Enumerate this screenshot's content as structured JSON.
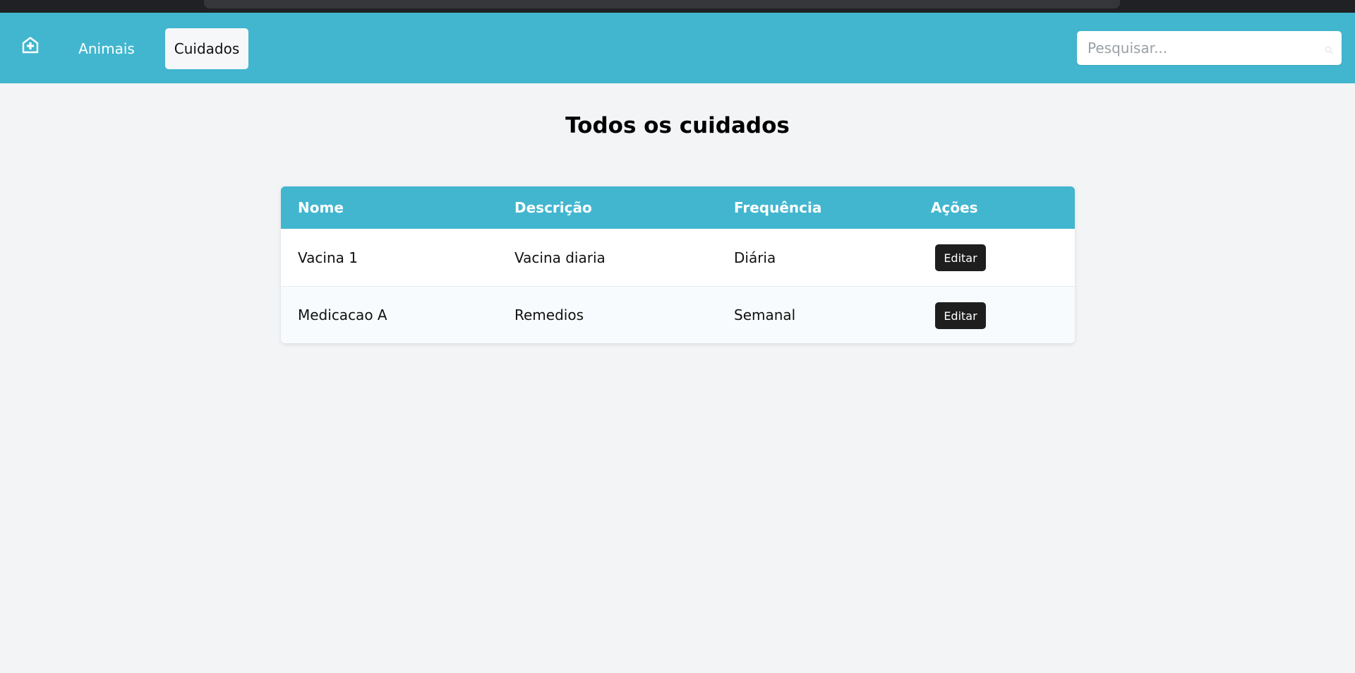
{
  "navbar": {
    "home_icon": "hospital-plus-icon",
    "links": [
      {
        "label": "Animais",
        "active": false
      },
      {
        "label": "Cuidados",
        "active": true
      }
    ],
    "search": {
      "placeholder": "Pesquisar...",
      "value": "",
      "icon": "search-icon"
    },
    "colors": {
      "bar": "#42b6cf",
      "active_link_bg": "#f6f7f9"
    }
  },
  "main": {
    "title": "Todos os cuidados",
    "table": {
      "headers": [
        "Nome",
        "Descrição",
        "Frequência",
        "Ações"
      ],
      "rows": [
        {
          "nome": "Vacina 1",
          "descricao": "Vacina diaria",
          "frequencia": "Diária",
          "action_label": "Editar"
        },
        {
          "nome": "Medicacao A",
          "descricao": "Remedios",
          "frequencia": "Semanal",
          "action_label": "Editar"
        }
      ]
    }
  }
}
